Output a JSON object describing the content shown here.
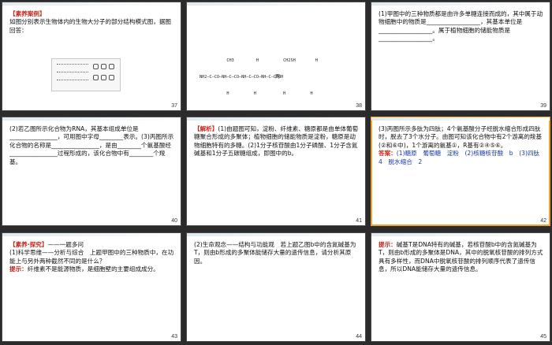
{
  "slides": [
    {
      "number": "37",
      "title": "【素养案例】",
      "text": "如图分别表示生物体内的生物大分子的部分结构模式图，据图回答："
    },
    {
      "number": "38",
      "formula_top": "           CH3         H          CH2SH        H",
      "formula_mid": "NH2—C—CO—NH—C—CO—NH—C—CO—NH—C—COOH",
      "formula_bot": "           H          H           H          H",
      "formula_label": "丙"
    },
    {
      "number": "39",
      "text": "(1)甲图中的三种物质都是由许多单糖连接而成的，其中属于动物细胞中的物质是__________________，其基本单位是__________________。属于植物细胞的储能物质是__________________。"
    },
    {
      "number": "40",
      "text": "(2)若乙图所示化合物为RNA，其基本组成单位是________________，可用图中字母________表示。(3)丙图所示化合物的名称是________________，是由________个氨基酸经________________过程形成的，该化合物中有________个羧基。"
    },
    {
      "number": "41",
      "label": "【解析】",
      "text": "(1)由题图可知，淀粉、纤维素、糖原都是由单体葡萄糖聚合形成的多聚体；植物细胞的储能物质是淀粉，糖原是动物细胞特有的多糖。(2)1分子核苷酸由1分子磷酸、1分子含氮碱基和1分子五碳糖组成，即图中的b。"
    },
    {
      "number": "42",
      "text": "(3)丙图所示多肽为四肽；4个氨基酸分子经脱水缩合形成四肽时，脱去了3个水分子。由图可知该化合物中有2个游离的羧基(②和⑥中)，1个游离的氨基①，R基有②④⑤⑥。",
      "answer_label": "答案：",
      "answer": "(1)糖原　葡萄糖　淀粉　(2)核糖核苷酸　b　(3)四肽　4　脱水缩合　2"
    },
    {
      "number": "43",
      "title": "【素养·探究】",
      "title_rest": "——一题多问",
      "text": "(1)科学思维——分析与综合　上题甲图中的三种物质中，在功能上与另外两种截然不同的是什么？",
      "hint_label": "提示：",
      "hint": "纤维素不是能源物质，是细胞壁的主要组成成分。"
    },
    {
      "number": "44",
      "text": "(2)生命观念——结构与功能观　若上题乙图b中的含氮碱基为T，则由b形成的多聚体能储存大量的遗传信息，请分析其原因。"
    },
    {
      "number": "45",
      "hint_label": "提示：",
      "hint": "碱基T是DNA特有的碱基，若核苷酸b中的含氮碱基为T，则由b形成的多聚体是DNA，其中的脱氧核苷酸的排列方式具有多样性，而DNA中脱氧核苷酸的排列顺序代表了遗传信息，所以DNA能储存大量的遗传信息。"
    }
  ]
}
